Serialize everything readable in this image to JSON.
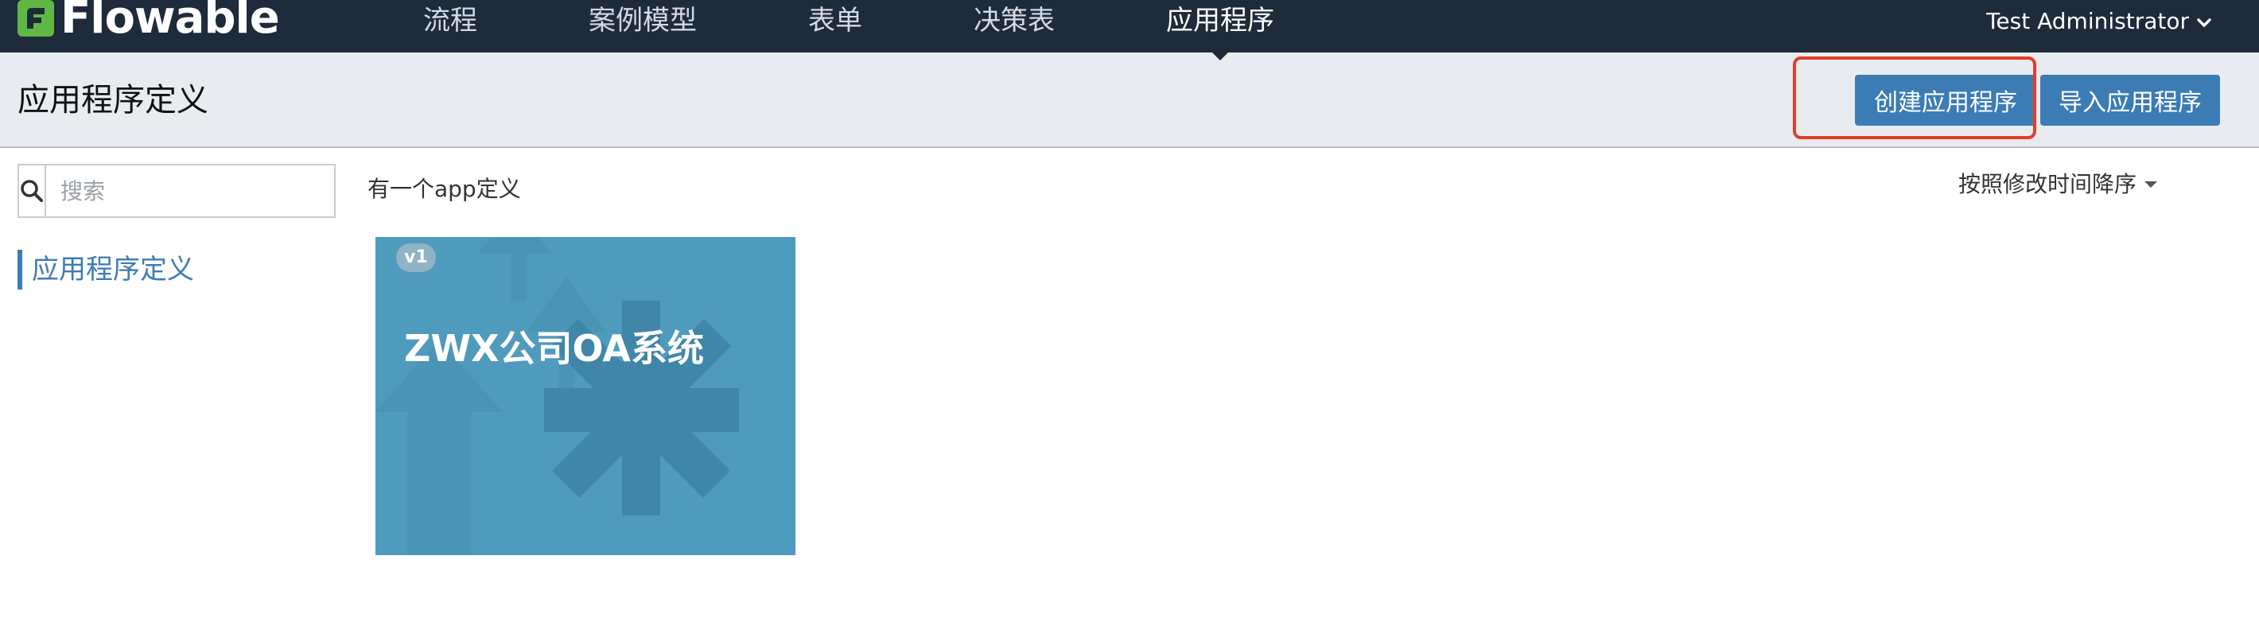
{
  "brand": {
    "name": "Flowable"
  },
  "nav": {
    "items": [
      {
        "label": "流程"
      },
      {
        "label": "案例模型"
      },
      {
        "label": "表单"
      },
      {
        "label": "决策表"
      },
      {
        "label": "应用程序"
      }
    ],
    "active_index": 4
  },
  "user": {
    "name": "Test Administrator"
  },
  "header": {
    "title": "应用程序定义",
    "create_label": "创建应用程序",
    "import_label": "导入应用程序"
  },
  "sidebar": {
    "search_placeholder": "搜索",
    "items": [
      {
        "label": "应用程序定义"
      }
    ]
  },
  "content": {
    "count_text": "有一个app定义",
    "sort_label": "按照修改时间降序",
    "apps": [
      {
        "version": "v1",
        "title": "ZWX公司OA系统"
      }
    ]
  },
  "colors": {
    "nav_bg": "#1e2b3b",
    "accent": "#3c7cb5",
    "card_bg": "#4f9bbd",
    "highlight": "#e23d2a"
  },
  "icons": {
    "logo": "flowable-logo-icon",
    "user_menu": "chevron-down-icon",
    "search": "search-icon",
    "sort": "caret-down-icon"
  }
}
